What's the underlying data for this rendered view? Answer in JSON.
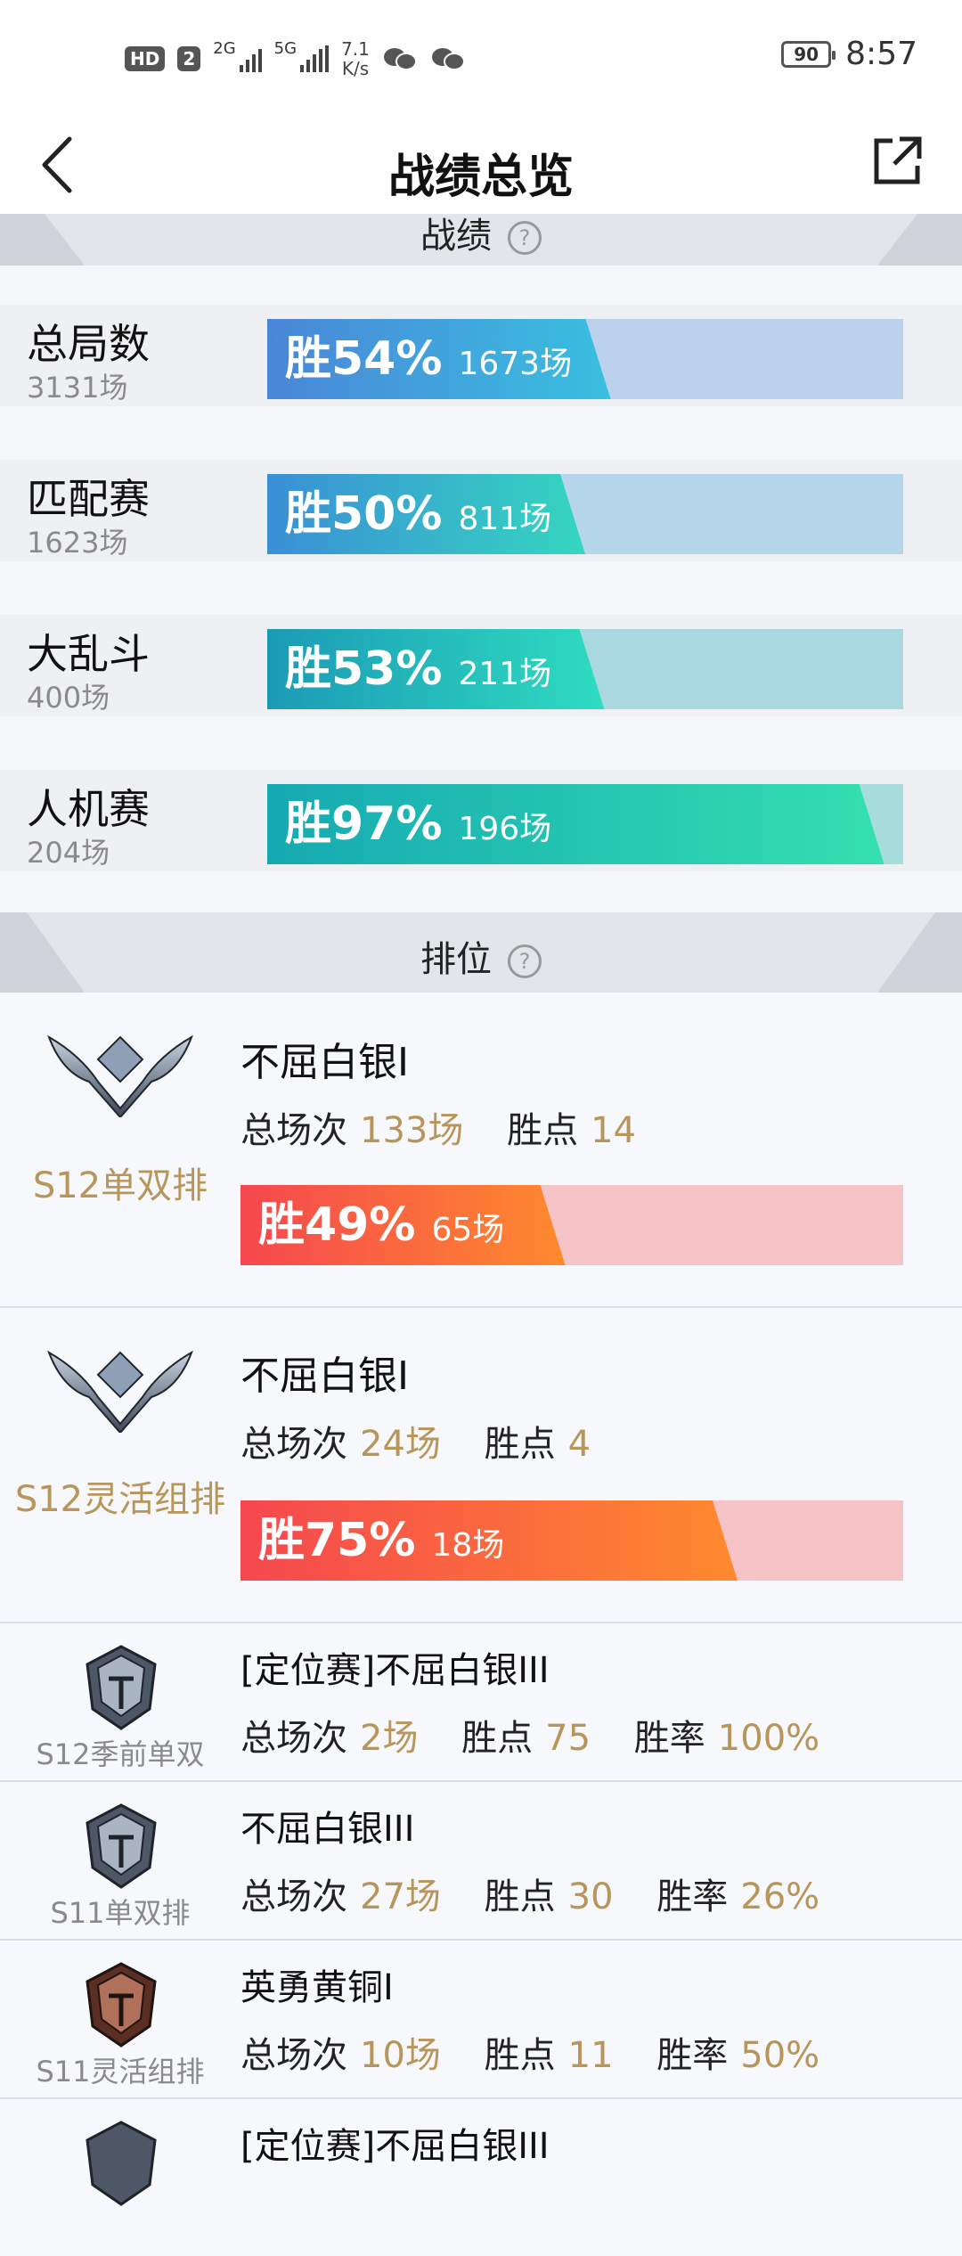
{
  "status_bar": {
    "hd": "HD",
    "sim": "2",
    "net1": "2G",
    "net2": "5G",
    "speed_value": "7.1",
    "speed_unit": "K/s",
    "battery": "90",
    "time": "8:57"
  },
  "nav": {
    "title": "战绩总览"
  },
  "record_section": {
    "title": "战绩",
    "help": "?"
  },
  "stats": [
    {
      "name": "总局数",
      "count": "3131场",
      "win_label": "胜54%",
      "wins": "1673场",
      "win_rate": 0.54,
      "fill_color_start": "#4a86d8",
      "fill_color_end": "#39c0e0",
      "track_color": "#bcd2ec"
    },
    {
      "name": "匹配赛",
      "count": "1623场",
      "win_label": "胜50%",
      "wins": "811场",
      "win_rate": 0.5,
      "fill_color_start": "#3a8fd6",
      "fill_color_end": "#35d6c0",
      "track_color": "#b6d6ea"
    },
    {
      "name": "大乱斗",
      "count": "400场",
      "win_label": "胜53%",
      "wins": "211场",
      "win_rate": 0.53,
      "fill_color_start": "#1b9ab6",
      "fill_color_end": "#2fdcc0",
      "track_color": "#a9d8e0"
    },
    {
      "name": "人机赛",
      "count": "204场",
      "win_label": "胜97%",
      "wins": "196场",
      "win_rate": 0.97,
      "fill_color_start": "#16a9b2",
      "fill_color_end": "#34e0b0",
      "track_color": "#a7dedc"
    }
  ],
  "ranked_section": {
    "title": "排位",
    "help": "?"
  },
  "ranked_main": [
    {
      "mode": "S12单双排",
      "tier": "不屈白银I",
      "total_label": "总场次",
      "total": "133场",
      "lp_label": "胜点",
      "lp": "14",
      "win_label": "胜49%",
      "wins": "65场",
      "win_rate": 0.49
    },
    {
      "mode": "S12灵活组排",
      "tier": "不屈白银I",
      "total_label": "总场次",
      "total": "24场",
      "lp_label": "胜点",
      "lp": "4",
      "win_label": "胜75%",
      "wins": "18场",
      "win_rate": 0.75
    }
  ],
  "ranked_small": [
    {
      "mode": "S12季前单双",
      "tier": "[定位赛]不屈白银III",
      "total_label": "总场次",
      "total": "2场",
      "lp_label": "胜点",
      "lp": "75",
      "rate_label": "胜率",
      "rate": "100%",
      "icon": "silver-helmet-icon"
    },
    {
      "mode": "S11单双排",
      "tier": "不屈白银III",
      "total_label": "总场次",
      "total": "27场",
      "lp_label": "胜点",
      "lp": "30",
      "rate_label": "胜率",
      "rate": "26%",
      "icon": "silver-helmet-icon"
    },
    {
      "mode": "S11灵活组排",
      "tier": "英勇黄铜I",
      "total_label": "总场次",
      "total": "10场",
      "lp_label": "胜点",
      "lp": "11",
      "rate_label": "胜率",
      "rate": "50%",
      "icon": "bronze-helmet-icon"
    },
    {
      "mode": "",
      "tier": "[定位赛]不屈白银III",
      "total_label": "",
      "total": "",
      "lp_label": "",
      "lp": "",
      "rate_label": "",
      "rate": "",
      "icon": "silver-helmet-icon"
    }
  ],
  "colors": {
    "accent_gold": "#b8955a",
    "rank_bar_start": "#f5474f",
    "rank_bar_end": "#ff8a2e",
    "rank_bar_track": "#f6c4c6"
  }
}
